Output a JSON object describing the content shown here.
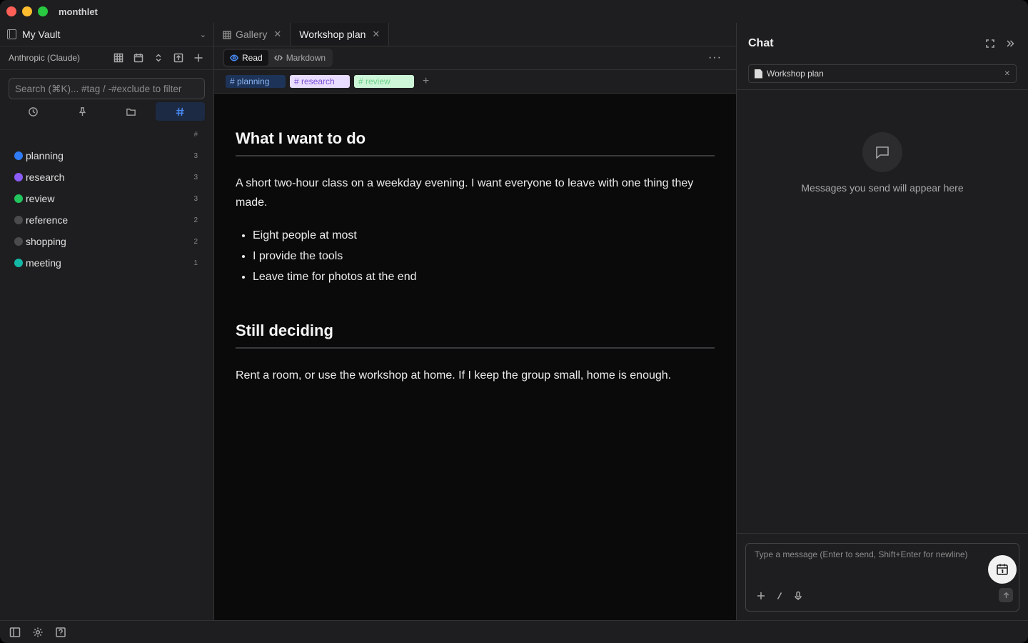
{
  "app": {
    "title": "monthlet"
  },
  "sidebar": {
    "vault_name": "My Vault",
    "model_name": "Anthropic (Claude)",
    "search_placeholder": "Search (⌘K)... #tag / -#exclude to filter",
    "tag_header": "#",
    "tags": [
      {
        "name": "planning",
        "count": "3",
        "color": "#2f7cf6"
      },
      {
        "name": "research",
        "count": "3",
        "color": "#8b5cf6"
      },
      {
        "name": "review",
        "count": "3",
        "color": "#22c55e"
      },
      {
        "name": "reference",
        "count": "2",
        "color": "#4b4b4e"
      },
      {
        "name": "shopping",
        "count": "2",
        "color": "#4b4b4e"
      },
      {
        "name": "meeting",
        "count": "1",
        "color": "#14b8a6"
      }
    ]
  },
  "editor": {
    "tabs": [
      {
        "label": "Gallery",
        "active": false
      },
      {
        "label": "Workshop plan",
        "active": true
      }
    ],
    "modes": {
      "read": "Read",
      "markdown": "Markdown"
    },
    "chips": [
      "# planning",
      "# research",
      "# review"
    ],
    "doc": {
      "h1": "What I want to do",
      "p1": "A short two-hour class on a weekday evening. I want everyone to leave with one thing they made.",
      "bullets": [
        "Eight people at most",
        "I provide the tools",
        "Leave time for photos at the end"
      ],
      "h2": "Still deciding",
      "p2": "Rent a room, or use the workshop at home. If I keep the group small, home is enough."
    }
  },
  "chat": {
    "title": "Chat",
    "context_file": "Workshop plan",
    "empty_text": "Messages you send will appear here",
    "input_placeholder": "Type a message (Enter to send, Shift+Enter for newline)"
  }
}
